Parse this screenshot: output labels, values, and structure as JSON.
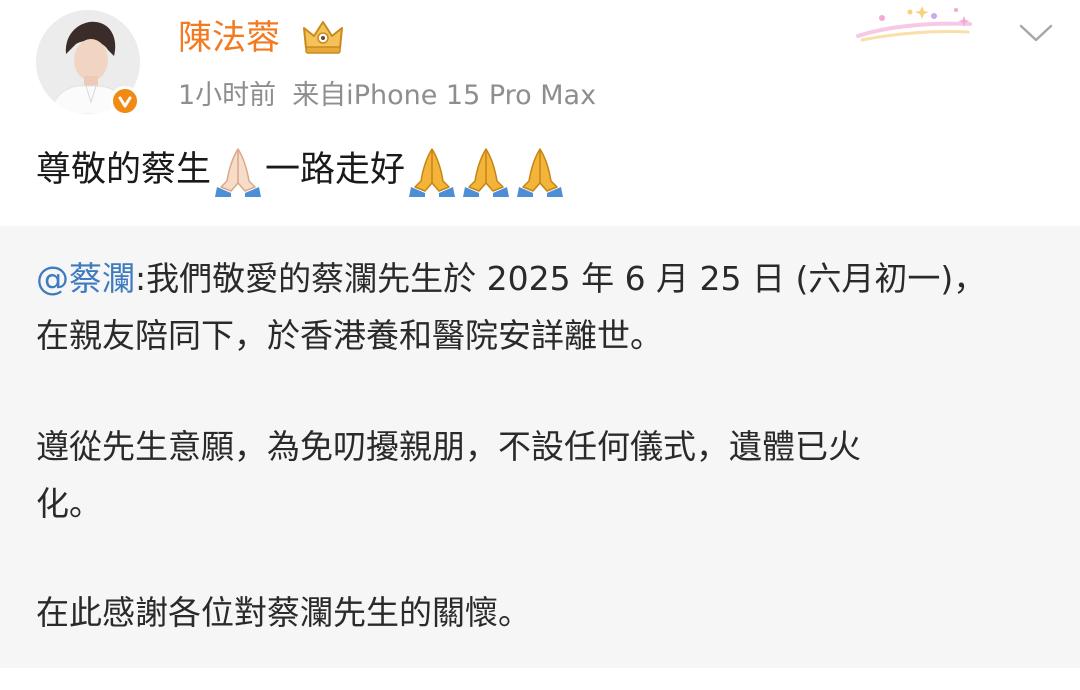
{
  "header": {
    "username": "陳法蓉",
    "time": "1小时前",
    "source": "来自iPhone 15 Pro Max"
  },
  "post": {
    "text_part1": "尊敬的蔡生",
    "text_part2": "一路走好"
  },
  "repost": {
    "mention": "@蔡瀾",
    "line1_rest": ":我們敬愛的蔡瀾先生於 2025 年 6 月 25 日 (六月初一)，",
    "line2": "在親友陪同下，於香港養和醫院安詳離世。",
    "line3": "遵從先生意願，為免叨擾親朋，不設任何儀式，遺體已火",
    "line4": "化。",
    "line5": "在此感謝各位對蔡瀾先生的關懷。"
  },
  "colors": {
    "username": "#f37a20",
    "mention": "#3f7bbf",
    "meta": "#8e8e8e",
    "repost_bg": "#f6f6f6",
    "verified_badge": "#f08a13"
  },
  "icons": [
    "avatar",
    "verified-badge-icon",
    "crown-icon",
    "decorative-sparkle-icon",
    "chevron-down-icon",
    "praying-hands-icon"
  ]
}
